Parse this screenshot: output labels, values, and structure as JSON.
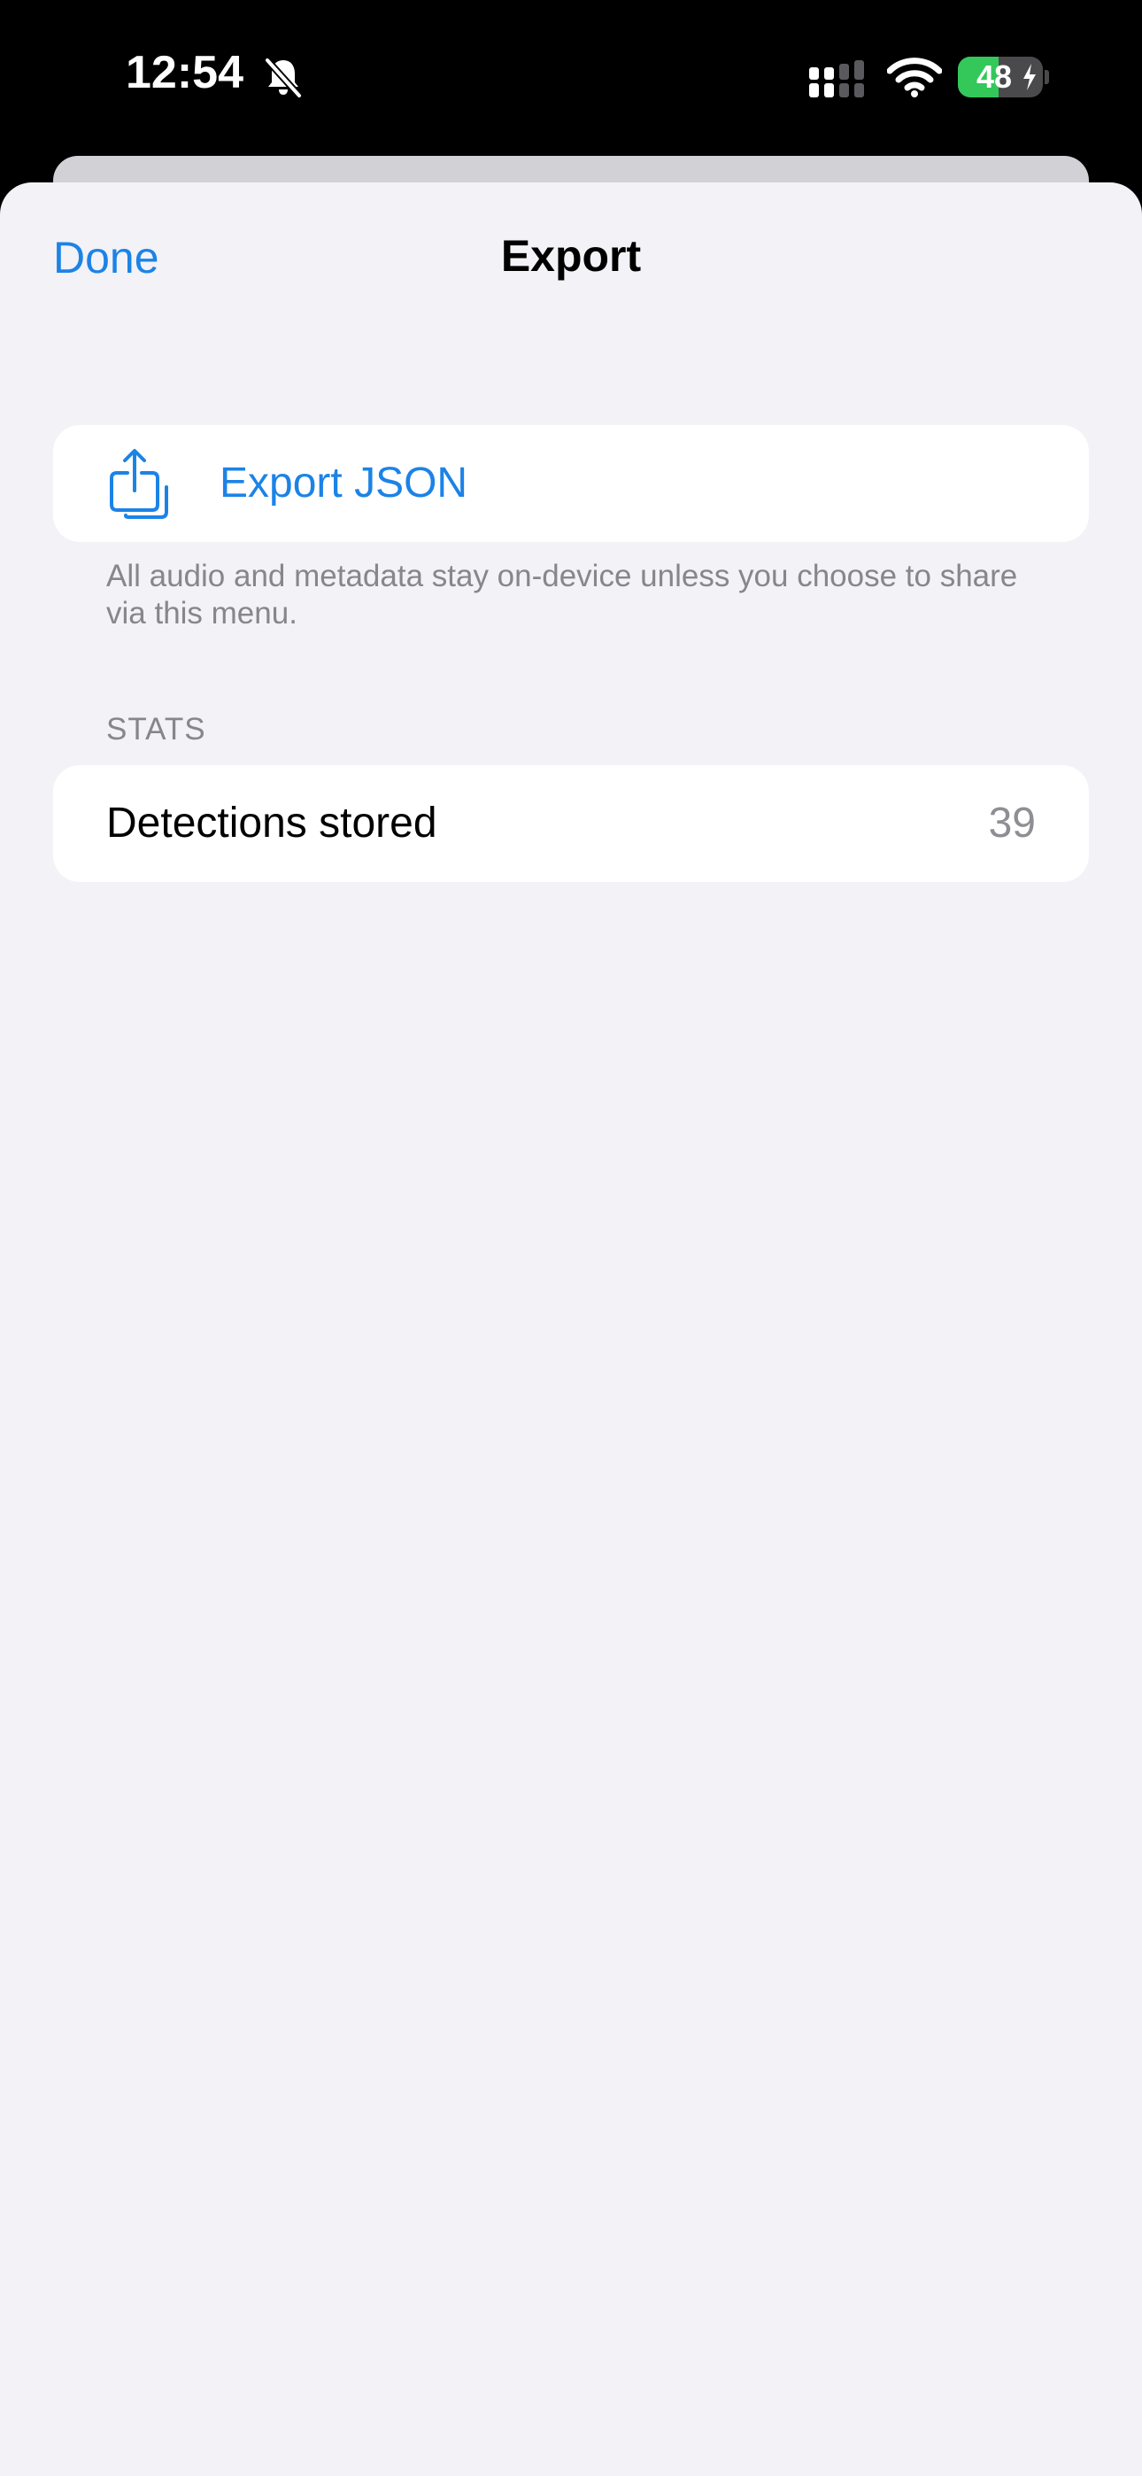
{
  "status_bar": {
    "time": "12:54",
    "battery_percent": 48,
    "battery_label": "48"
  },
  "sheet": {
    "nav": {
      "done_label": "Done",
      "title": "Export"
    },
    "export_action": {
      "label": "Export JSON",
      "icon": "share-icon"
    },
    "footer_note": "All audio and metadata stay on-device unless you choose to share via this menu.",
    "stats_section": {
      "header": "STATS",
      "rows": [
        {
          "label": "Detections stored",
          "value": "39"
        }
      ]
    }
  },
  "colors": {
    "accent": "#1c83e6",
    "background": "#f2f2f7",
    "card": "#ffffff",
    "secondary_text": "#86868b",
    "battery_fill": "#34c759"
  }
}
